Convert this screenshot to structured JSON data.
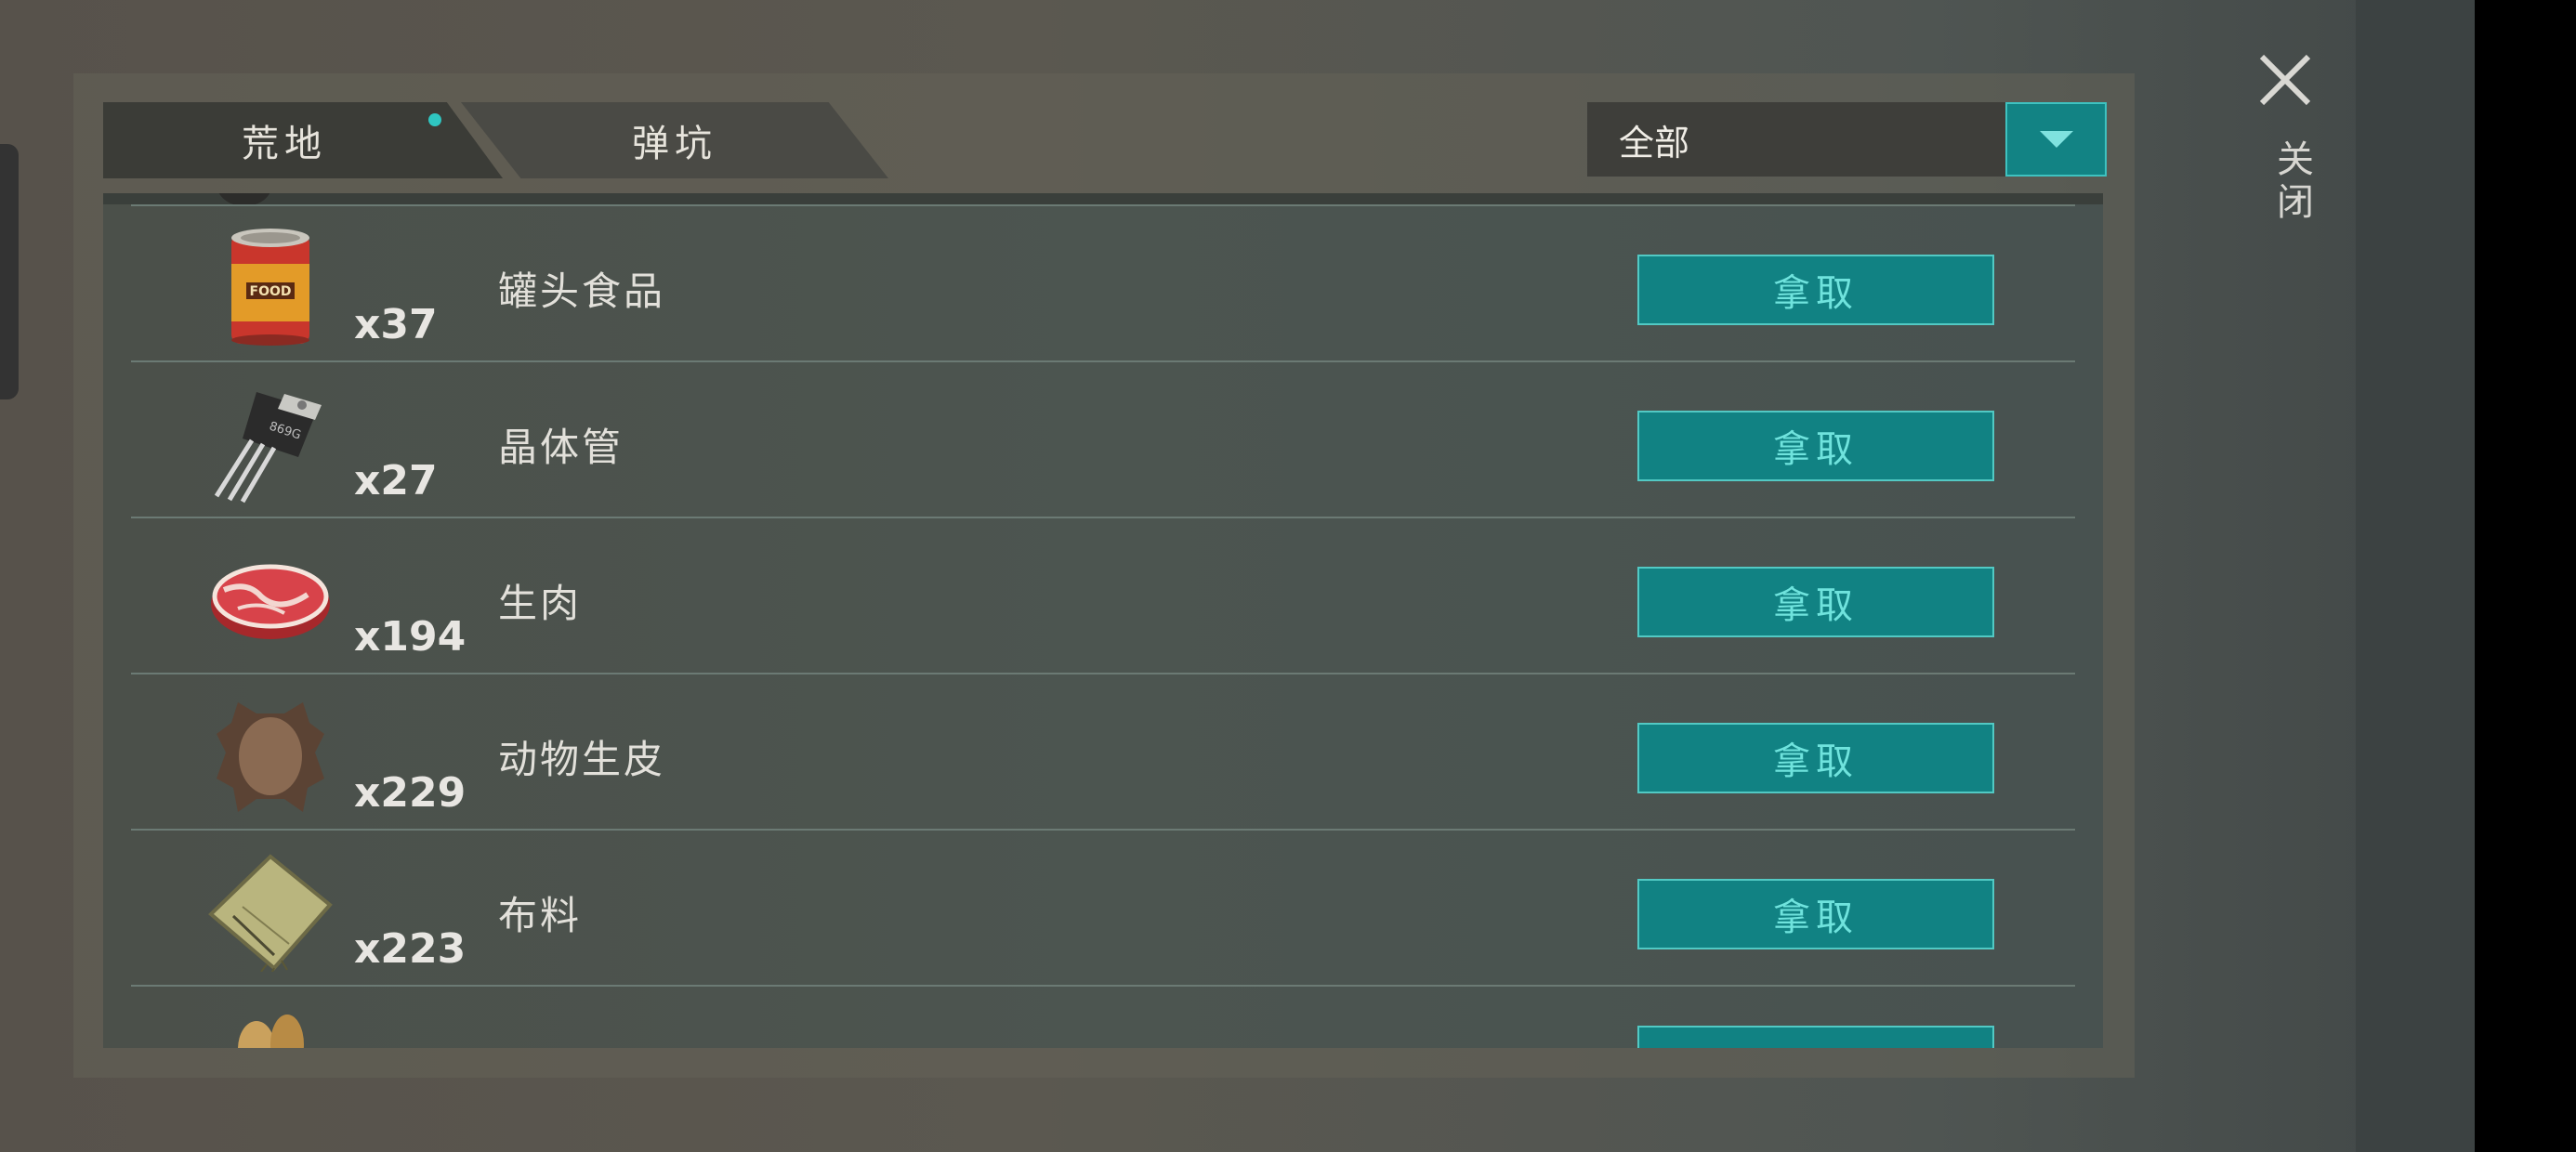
{
  "tabs": [
    {
      "label": "荒地",
      "active": true,
      "has_notification": true
    },
    {
      "label": "弹坑",
      "active": false
    }
  ],
  "filter": {
    "selected": "全部"
  },
  "close": {
    "label": "关闭"
  },
  "items": [
    {
      "icon": "canned-food-icon",
      "qty": "x37",
      "name": "罐头食品",
      "action": "拿取",
      "icon_text": "FOOD"
    },
    {
      "icon": "transistor-icon",
      "qty": "x27",
      "name": "晶体管",
      "action": "拿取",
      "icon_text": "869G"
    },
    {
      "icon": "raw-meat-icon",
      "qty": "x194",
      "name": "生肉",
      "action": "拿取"
    },
    {
      "icon": "animal-hide-icon",
      "qty": "x229",
      "name": "动物生皮",
      "action": "拿取"
    },
    {
      "icon": "cloth-icon",
      "qty": "x223",
      "name": "布料",
      "action": "拿取"
    }
  ],
  "colors": {
    "accent": "#118283",
    "accent_text": "#6fe3dd",
    "notification": "#2fc6c1"
  }
}
